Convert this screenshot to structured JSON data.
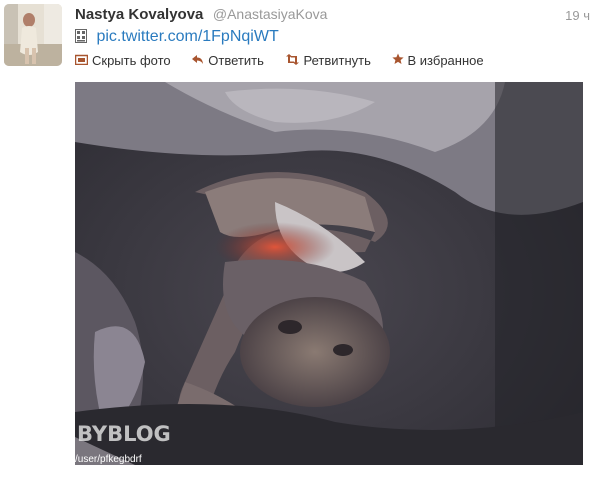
{
  "tweet": {
    "fullname": "Nastya Kovalyova",
    "username": "@AnastasiyaKova",
    "time": "19 ч",
    "pic_link": "pic.twitter.com/1FpNqiWT",
    "actions": {
      "hide_photo": "Скрыть фото",
      "reply": "Ответить",
      "retweet": "Ретвитнуть",
      "favorite": "В избранное"
    },
    "photo": {
      "watermark": "BYBLOG",
      "watermark_url": "/user/pfkegbdrf"
    }
  },
  "colors": {
    "link": "#2a7bbf",
    "action_icon": "#a8552f",
    "muted": "#999999"
  },
  "icons": {
    "pic": "pic-icon",
    "hide_photo": "photo-icon",
    "reply": "reply-icon",
    "retweet": "retweet-icon",
    "favorite": "star-icon"
  }
}
